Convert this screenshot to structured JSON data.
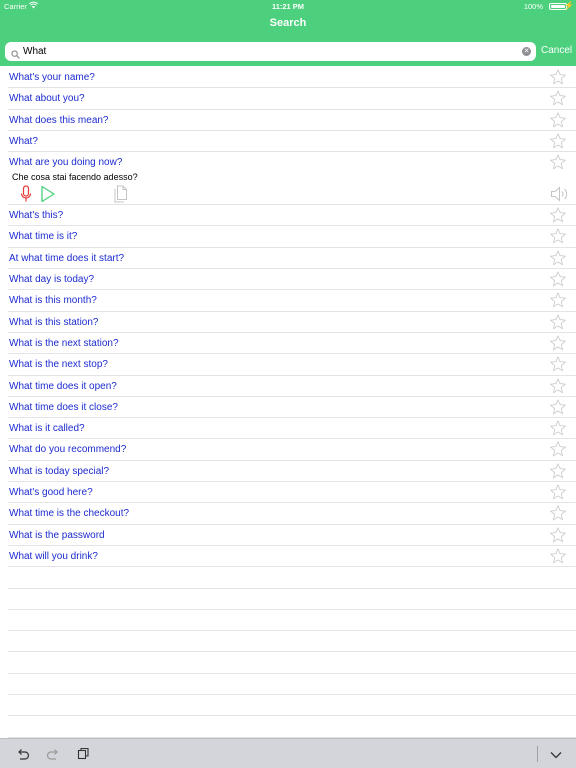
{
  "status_bar": {
    "carrier": "Carrier",
    "time": "11:21 PM",
    "battery": "100%"
  },
  "nav": {
    "title": "Search",
    "cancel_label": "Cancel"
  },
  "search": {
    "value": "What",
    "placeholder": ""
  },
  "colors": {
    "header": "#4cd07d",
    "phrase_text": "#1c2bd0",
    "mic": "#e53935",
    "play": "#4cd07d",
    "toolbar": "#d3d5da"
  },
  "results": [
    "What's your name?",
    "What about you?",
    "What does this mean?",
    "What?",
    "What are you doing now?",
    "What's this?",
    "What time is it?",
    "At what time does it start?",
    "What day is today?",
    "What is this month?",
    "What is this station?",
    "What is the next station?",
    "What is the next stop?",
    "What time does it open?",
    "What time does it close?",
    "What is it called?",
    "What do you recommend?",
    "What is today special?",
    "What's good here?",
    "What time is the checkout?",
    "What is the password",
    "What will you drink?"
  ],
  "expanded": {
    "phrase": "What are you doing now?",
    "translation": "Che cosa stai facendo adesso?"
  },
  "icons": {
    "star": "star-outline-icon",
    "mic": "microphone-icon",
    "play": "play-icon",
    "copy": "copy-icon",
    "speaker": "speaker-icon",
    "undo": "undo-icon",
    "redo": "redo-icon",
    "paste": "clipboard-icon",
    "dismiss": "chevron-down-icon"
  }
}
